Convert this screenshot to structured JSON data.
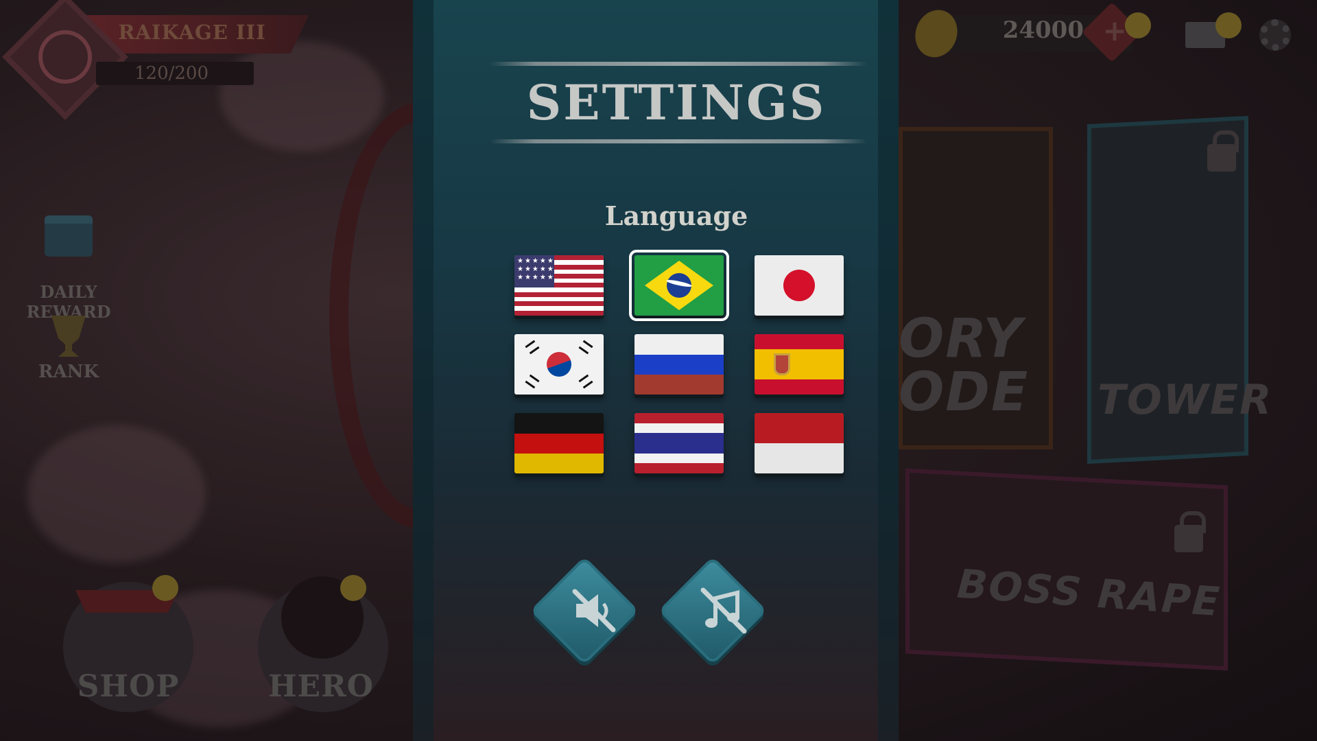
{
  "background": {
    "rank_title": "RAIKAGE III",
    "xp_text": "120/200",
    "daily_reward_label": "DAILY\nREWARD",
    "rank_label": "RANK",
    "shop_label": "SHOP",
    "hero_label": "HERO",
    "currency_value": "24000",
    "story_mode_label": "ORY\nODE",
    "tower_label": "TOWER",
    "boss_label": "BOSS RAPE"
  },
  "settings": {
    "title": "SETTINGS",
    "language_label": "Language",
    "selected_language": "pt-BR",
    "languages": [
      {
        "code": "en-US",
        "icon": "us-flag-icon"
      },
      {
        "code": "pt-BR",
        "icon": "brazil-flag-icon"
      },
      {
        "code": "ja-JP",
        "icon": "japan-flag-icon"
      },
      {
        "code": "ko-KR",
        "icon": "korea-flag-icon"
      },
      {
        "code": "ru-RU",
        "icon": "russia-flag-icon"
      },
      {
        "code": "es-ES",
        "icon": "spain-flag-icon"
      },
      {
        "code": "de-DE",
        "icon": "germany-flag-icon"
      },
      {
        "code": "th-TH",
        "icon": "thailand-flag-icon"
      },
      {
        "code": "id-ID",
        "icon": "indonesia-flag-icon"
      }
    ],
    "sound_toggle": {
      "icon": "sound-muted-icon",
      "enabled": false
    },
    "music_toggle": {
      "icon": "music-muted-icon",
      "enabled": false
    }
  },
  "colors": {
    "panel_top": "#18444e",
    "panel_bottom": "#2a1e22",
    "button_teal": "#3e8ea0",
    "selected_outline": "#ffffff"
  }
}
